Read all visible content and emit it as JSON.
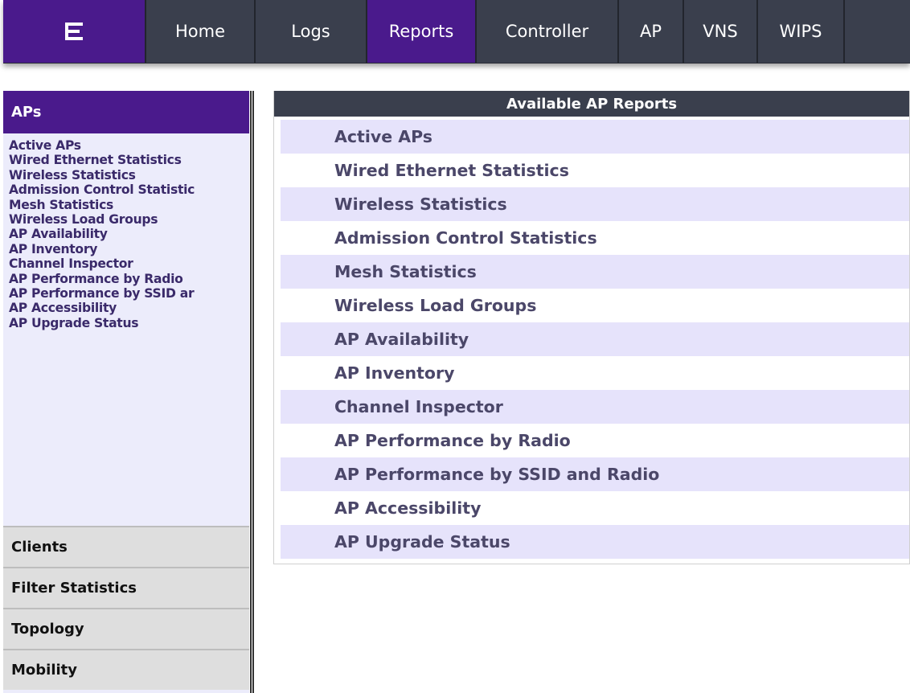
{
  "nav": {
    "logo_icon": "extreme-logo-icon",
    "tabs": [
      {
        "label": "Home",
        "active": false
      },
      {
        "label": "Logs",
        "active": false
      },
      {
        "label": "Reports",
        "active": true
      },
      {
        "label": "Controller",
        "active": false
      },
      {
        "label": "AP",
        "active": false
      },
      {
        "label": "VNS",
        "active": false
      },
      {
        "label": "WIPS",
        "active": false
      }
    ]
  },
  "sidebar": {
    "active_section": "APs",
    "items": [
      "Active APs",
      "Wired Ethernet Statistics",
      "Wireless Statistics",
      "Admission Control Statistic",
      "Mesh Statistics",
      "Wireless Load Groups",
      "AP Availability",
      "AP Inventory",
      "Channel Inspector",
      "AP Performance by Radio",
      "AP Performance by SSID ar",
      "AP Accessibility",
      "AP Upgrade Status"
    ],
    "sections": [
      "Clients",
      "Filter Statistics",
      "Topology",
      "Mobility"
    ]
  },
  "reports": {
    "title": "Available AP Reports",
    "rows": [
      "Active APs",
      "Wired Ethernet Statistics",
      "Wireless Statistics",
      "Admission Control Statistics",
      "Mesh Statistics",
      "Wireless Load Groups",
      "AP Availability",
      "AP Inventory",
      "Channel Inspector",
      "AP Performance by Radio",
      "AP Performance by SSID and Radio",
      "AP Accessibility",
      "AP Upgrade Status"
    ]
  },
  "colors": {
    "accent": "#4a1a8c",
    "nav_bg": "#3a3f4d",
    "row_alt": "#e6e3fb"
  }
}
